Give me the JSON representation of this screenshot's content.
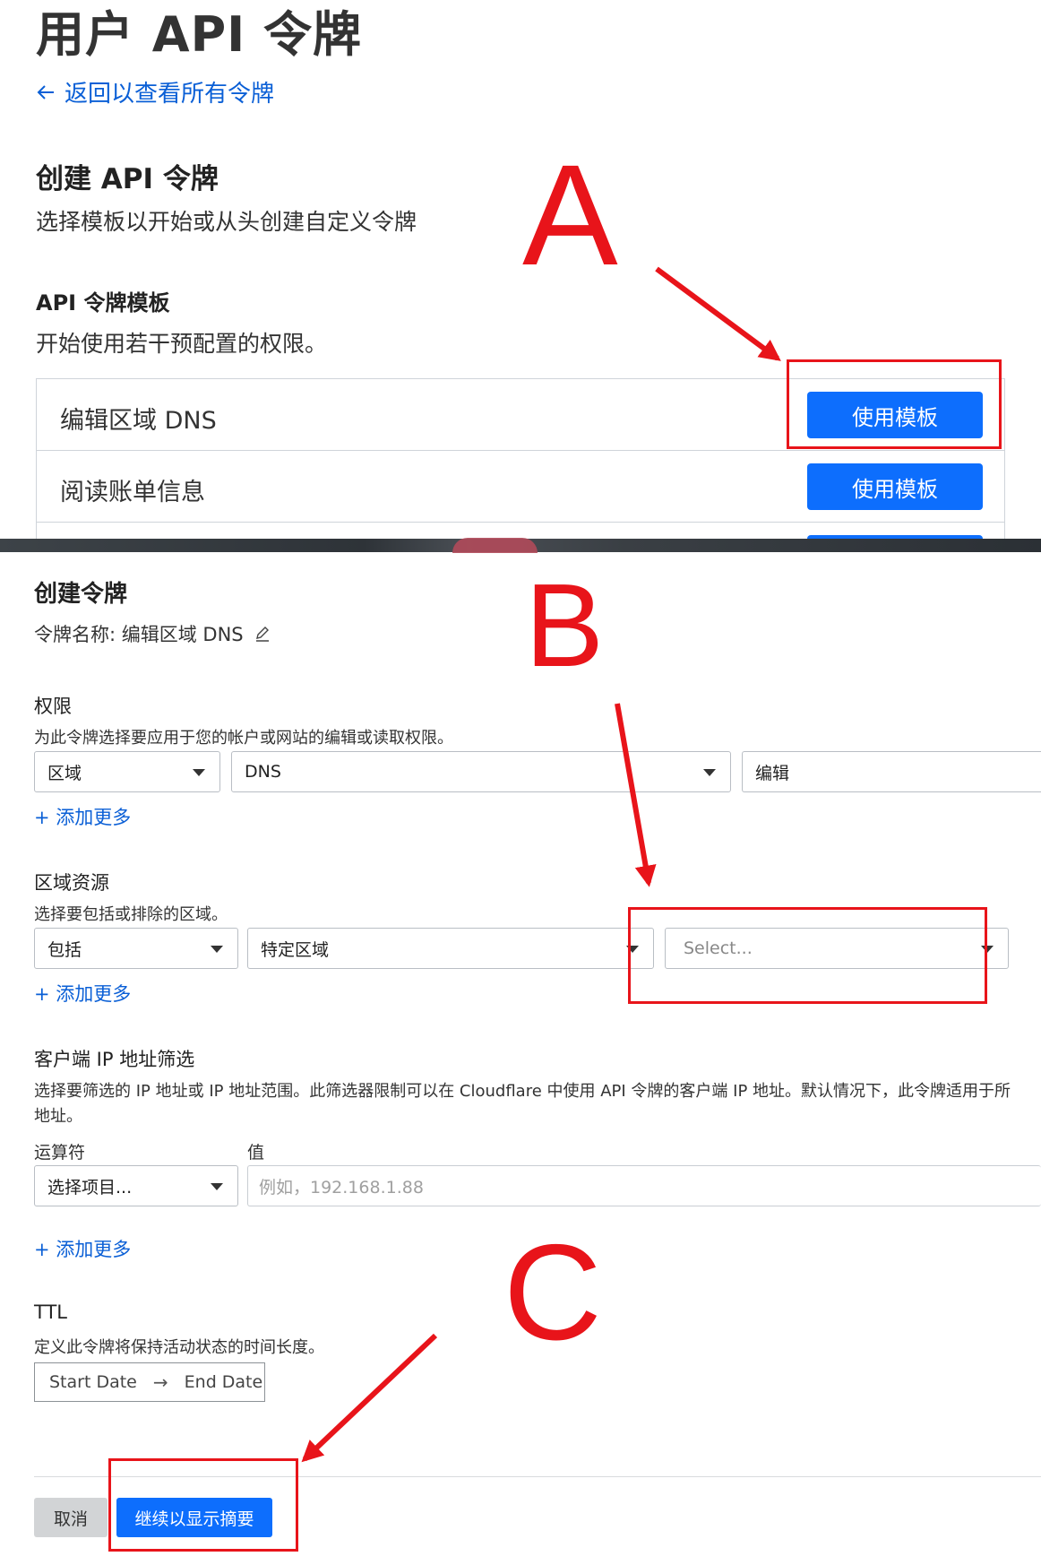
{
  "top": {
    "page_title": "用户 API 令牌",
    "back_link": "返回以查看所有令牌",
    "create_heading": "创建 API 令牌",
    "create_subtitle": "选择模板以开始或从头创建自定义令牌",
    "templates_heading": "API 令牌模板",
    "templates_subtitle": "开始使用若干预配置的权限。",
    "templates": [
      {
        "name": "编辑区域 DNS",
        "button": "使用模板"
      },
      {
        "name": "阅读账单信息",
        "button": "使用模板"
      }
    ]
  },
  "token": {
    "heading": "创建令牌",
    "name_line": "令牌名称: 编辑区域 DNS",
    "permissions": {
      "label": "权限",
      "description": "为此令牌选择要应用于您的帐户或网站的编辑或读取权限。",
      "scope": "区域",
      "resource": "DNS",
      "access": "编辑",
      "add_more": "+ 添加更多"
    },
    "zone_resources": {
      "label": "区域资源",
      "description": "选择要包括或排除的区域。",
      "mode": "包括",
      "type": "特定区域",
      "zone_select_placeholder": "Select...",
      "add_more": "+ 添加更多"
    },
    "ip_filter": {
      "label": "客户端 IP 地址筛选",
      "description_line1": "选择要筛选的 IP 地址或 IP 地址范围。此筛选器限制可以在 Cloudflare 中使用 API 令牌的客户端 IP 地址。默认情况下，此令牌适用于所",
      "description_line2": "地址。",
      "operator_label": "运算符",
      "value_label": "值",
      "operator_placeholder": "选择项目...",
      "value_placeholder": "例如，192.168.1.88",
      "add_more": "+ 添加更多"
    },
    "ttl": {
      "label": "TTL",
      "description": "定义此令牌将保持活动状态的时间长度。",
      "start": "Start Date",
      "arrow": "→",
      "end": "End Date"
    },
    "cancel_button": "取消",
    "continue_button": "继续以显示摘要"
  },
  "annotations": {
    "letter_a": "A",
    "letter_b": "B",
    "letter_c": "C",
    "color": "#e8141a"
  },
  "colors": {
    "primary_button": "#0d6efd",
    "link": "#0a5fd6"
  }
}
